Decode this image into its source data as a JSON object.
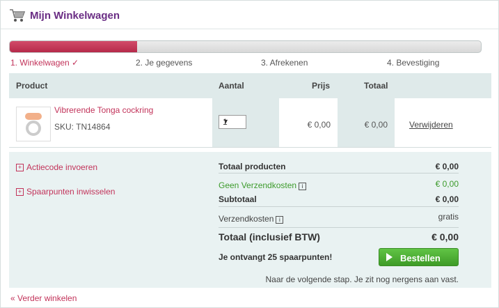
{
  "header": {
    "title": "Mijn Winkelwagen",
    "icon": "shopping-cart-icon"
  },
  "progress": {
    "fraction": 0.27
  },
  "steps": [
    "1. Winkelwagen ✓",
    "2. Je gegevens",
    "3. Afrekenen",
    "4. Bevestiging"
  ],
  "table": {
    "headers": {
      "product": "Product",
      "aantal": "Aantal",
      "prijs": "Prijs",
      "totaal": "Totaal"
    },
    "item": {
      "name": "Vibrerende Tonga cockring",
      "sku": "SKU: TN14864",
      "qty": "1",
      "price": "€ 0,00",
      "total": "€ 0,00",
      "remove": "Verwijderen"
    }
  },
  "summary": {
    "actiecode": "Actiecode invoeren",
    "spaarpunten": "Spaarpunten inwisselen",
    "totaal_producten": {
      "label": "Totaal producten",
      "value": "€ 0,00"
    },
    "geen_verzendkosten": {
      "label": "Geen Verzendkosten",
      "value": "€ 0,00"
    },
    "subtotaal": {
      "label": "Subtotaal",
      "value": "€ 0,00"
    },
    "verzendkosten": {
      "label": "Verzendkosten",
      "value": "gratis"
    },
    "totaal": {
      "label": "Totaal (inclusief BTW)",
      "value": "€ 0,00"
    },
    "spaarpunten_msg": "Je ontvangt 25 spaarpunten!",
    "bestellen": "Bestellen",
    "note": "Naar de volgende stap. Je zit nog nergens aan vast."
  },
  "verder": "« Verder winkelen",
  "colors": {
    "accent": "#c2335a",
    "title": "#6a2d84",
    "green": "#3d9b2c"
  }
}
